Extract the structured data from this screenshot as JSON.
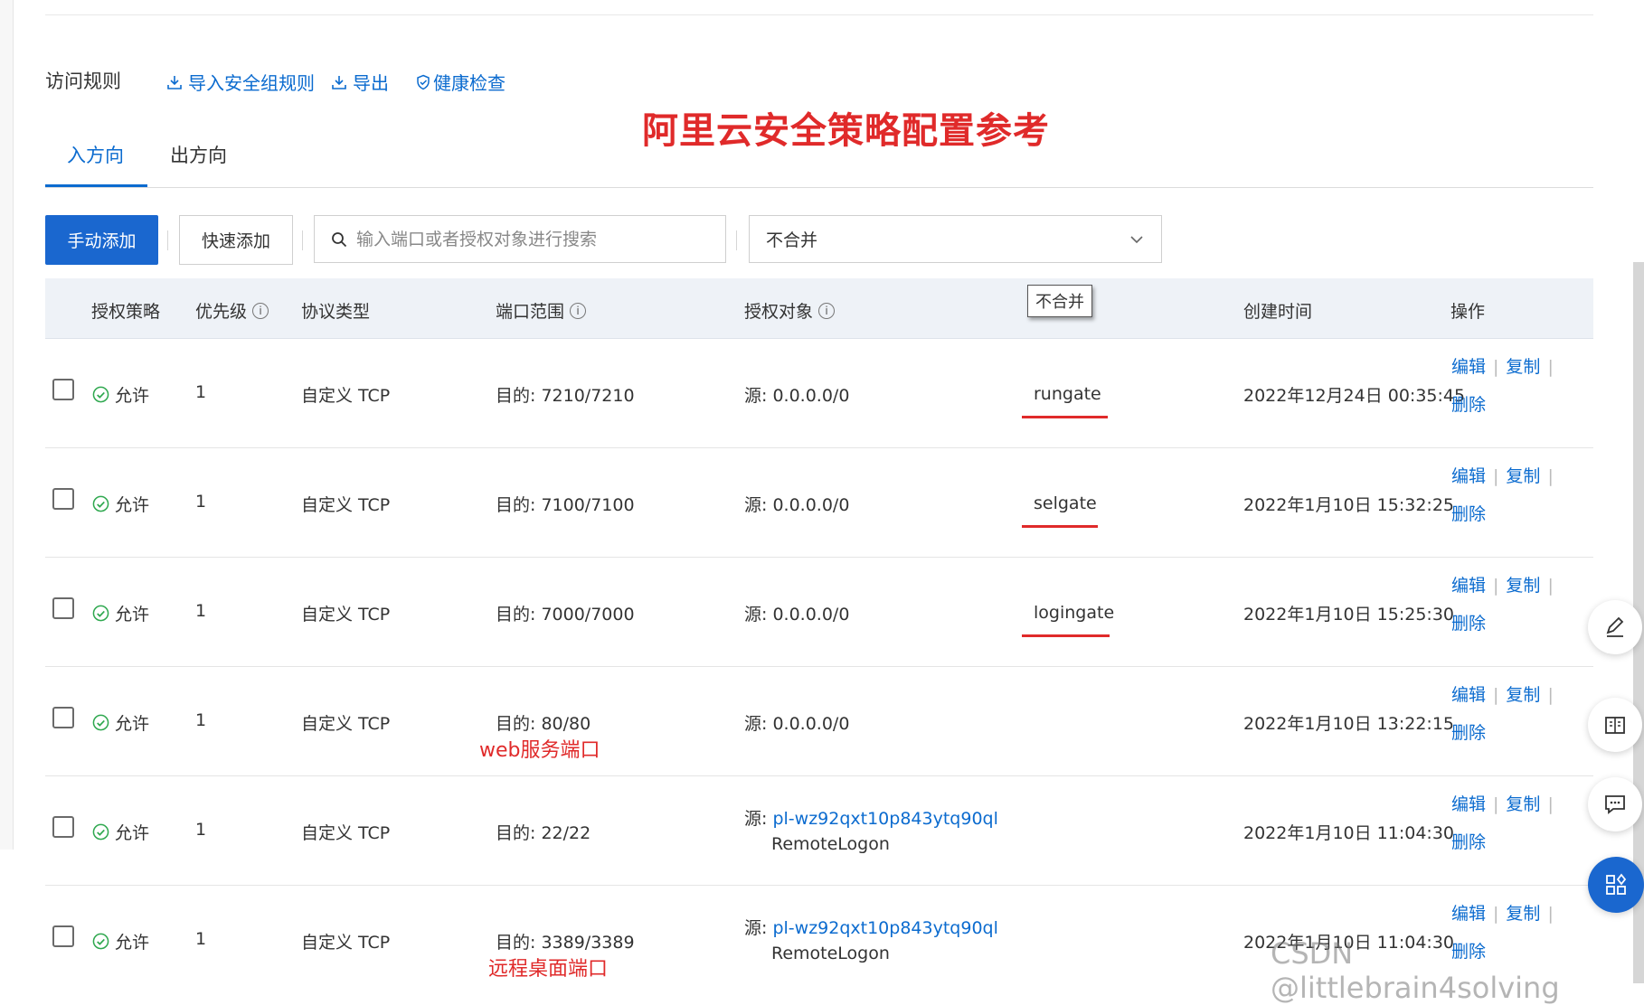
{
  "section": {
    "title": "访问规则",
    "links": [
      "导入安全组规则",
      "导出",
      "健康检查"
    ]
  },
  "annotation": {
    "title": "阿里云安全策略配置参考",
    "web_port_note": "web服务端口",
    "rdp_port_note": "远程桌面端口"
  },
  "tabs": [
    "入方向",
    "出方向"
  ],
  "toolbar": {
    "manual_add": "手动添加",
    "quick_add": "快速添加",
    "search_placeholder": "输入端口或者授权对象进行搜索",
    "merge_select": "不合并"
  },
  "tooltip": "不合并",
  "table": {
    "headers": [
      "授权策略",
      "优先级",
      "协议类型",
      "端口范围",
      "授权对象",
      "创建时间",
      "操作"
    ],
    "rows": [
      {
        "policy": "允许",
        "priority": "1",
        "protocol": "自定义 TCP",
        "port": "目的: 7210/7210",
        "source": "源: 0.0.0.0/0",
        "source_link": "",
        "source_sub": "",
        "desc": "rungate",
        "time": "2022年12月24日 00:35:45"
      },
      {
        "policy": "允许",
        "priority": "1",
        "protocol": "自定义 TCP",
        "port": "目的: 7100/7100",
        "source": "源: 0.0.0.0/0",
        "source_link": "",
        "source_sub": "",
        "desc": "selgate",
        "time": "2022年1月10日 15:32:25"
      },
      {
        "policy": "允许",
        "priority": "1",
        "protocol": "自定义 TCP",
        "port": "目的: 7000/7000",
        "source": "源: 0.0.0.0/0",
        "source_link": "",
        "source_sub": "",
        "desc": "logingate",
        "time": "2022年1月10日 15:25:30"
      },
      {
        "policy": "允许",
        "priority": "1",
        "protocol": "自定义 TCP",
        "port": "目的: 80/80",
        "source": "源: 0.0.0.0/0",
        "source_link": "",
        "source_sub": "",
        "desc": "",
        "time": "2022年1月10日 13:22:15"
      },
      {
        "policy": "允许",
        "priority": "1",
        "protocol": "自定义 TCP",
        "port": "目的: 22/22",
        "source": "源: ",
        "source_link": "pl-wz92qxt10p843ytq90ql",
        "source_sub": "RemoteLogon",
        "desc": "",
        "time": "2022年1月10日 11:04:30"
      },
      {
        "policy": "允许",
        "priority": "1",
        "protocol": "自定义 TCP",
        "port": "目的: 3389/3389",
        "source": "源: ",
        "source_link": "pl-wz92qxt10p843ytq90ql",
        "source_sub": "RemoteLogon",
        "desc": "",
        "time": "2022年1月10日 11:04:30"
      }
    ],
    "ops": {
      "edit": "编辑",
      "copy": "复制",
      "delete": "删除"
    }
  },
  "float_icons": [
    "pencil-icon",
    "book-icon",
    "chat-icon",
    "apps-icon"
  ],
  "watermark": "CSDN @littlebrain4solving",
  "colors": {
    "primary": "#1a67cf",
    "link": "#0b6bcf",
    "annotation_red": "#e02a2a",
    "allow_green": "#2fa84f"
  }
}
